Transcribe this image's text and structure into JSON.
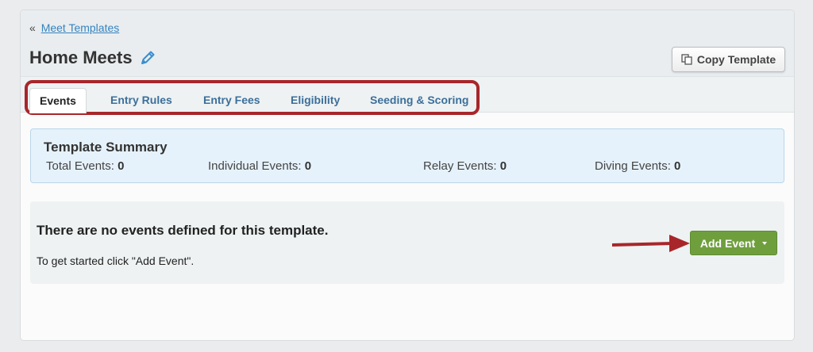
{
  "breadcrumb": {
    "prefix": "«",
    "link": "Meet Templates"
  },
  "page_title": "Home Meets",
  "icons": {
    "edit": "pencil-icon",
    "copy": "copy-icon",
    "dropdown": "caret-down-icon",
    "annotation": "red-arrow"
  },
  "copy_button": {
    "label": "Copy Template"
  },
  "tabs": [
    {
      "label": "Events",
      "active": true
    },
    {
      "label": "Entry Rules"
    },
    {
      "label": "Entry Fees"
    },
    {
      "label": "Eligibility"
    },
    {
      "label": "Seeding & Scoring"
    }
  ],
  "summary": {
    "title": "Template Summary",
    "stats": [
      {
        "label": "Total Events:",
        "value": "0"
      },
      {
        "label": "Individual Events:",
        "value": "0"
      },
      {
        "label": "Relay Events:",
        "value": "0"
      },
      {
        "label": "Diving Events:",
        "value": "0"
      }
    ]
  },
  "empty_state": {
    "title": "There are no events defined for this template.",
    "text": "To get started click \"Add Event\"."
  },
  "add_button": {
    "label": "Add Event"
  },
  "colors": {
    "link": "#3583c0",
    "tab_text": "#3c6f9a",
    "highlight": "#a8262a",
    "add_button": "#6f9f3d",
    "summary_bg": "#e6f2fb"
  }
}
